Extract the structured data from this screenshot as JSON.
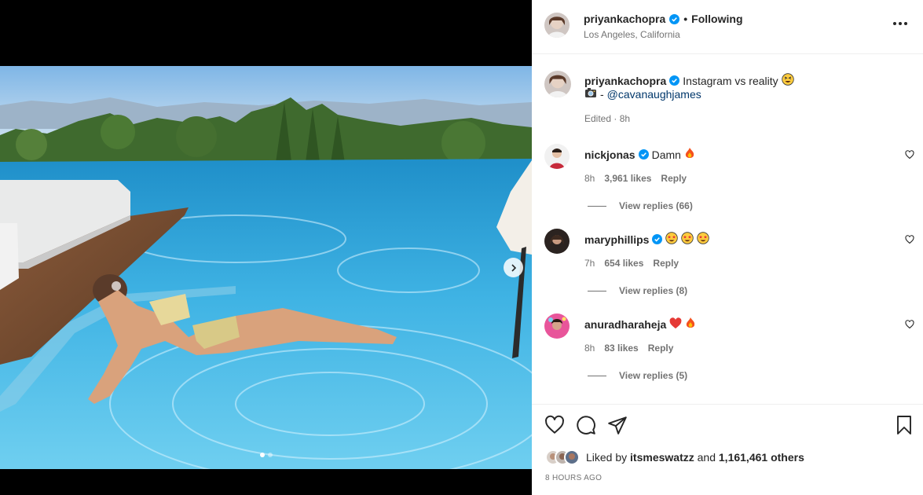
{
  "post": {
    "username": "priyankachopra",
    "follow_status": "Following",
    "separator": "•",
    "location": "Los Angeles, California",
    "carousel": {
      "dots": 2,
      "active_index": 0
    }
  },
  "caption": {
    "username": "priyankachopra",
    "text": "Instagram vs reality",
    "credit_prefix": "-",
    "mention": "@cavanaughjames",
    "edited": "Edited · 8h"
  },
  "comments": [
    {
      "username": "nickjonas",
      "verified": true,
      "text": "Damn",
      "emojis": [
        "fire"
      ],
      "age": "8h",
      "likes": "3,961 likes",
      "reply_label": "Reply",
      "view_replies": "View replies (66)"
    },
    {
      "username": "maryphillips",
      "verified": true,
      "text": "",
      "emojis": [
        "star-struck",
        "star-struck",
        "star-struck"
      ],
      "age": "7h",
      "likes": "654 likes",
      "reply_label": "Reply",
      "view_replies": "View replies (8)"
    },
    {
      "username": "anuradharaheja",
      "verified": false,
      "text": "",
      "emojis": [
        "red-heart",
        "fire"
      ],
      "age": "8h",
      "likes": "83 likes",
      "reply_label": "Reply",
      "view_replies": "View replies (5)"
    }
  ],
  "likes": {
    "prefix": "Liked by",
    "user": "itsmeswatzz",
    "conjunction": "and",
    "others": "1,161,461 others"
  },
  "timestamp": "8 HOURS AGO",
  "icons": {
    "like": "heart-icon",
    "comment": "comment-icon",
    "share": "send-icon",
    "save": "bookmark-icon",
    "more": "more-options-icon",
    "verified": "verified-badge-icon"
  },
  "colors": {
    "verified": "#0095f6",
    "mention": "#00376b",
    "secondary_text": "#737373"
  }
}
